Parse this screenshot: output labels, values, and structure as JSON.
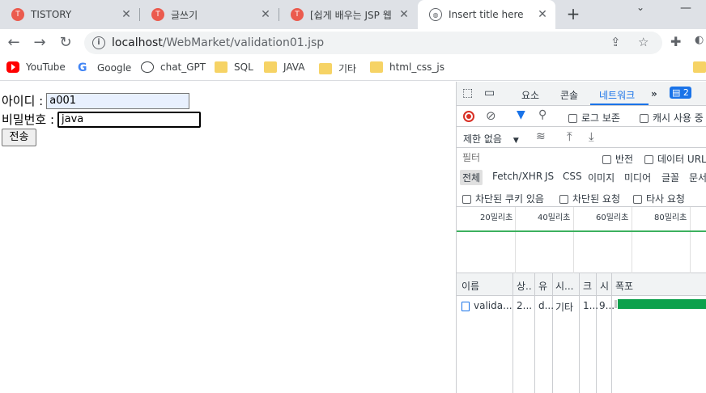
{
  "browser": {
    "tabs": [
      {
        "title": "TISTORY",
        "favicon": "tistory-icon"
      },
      {
        "title": "글쓰기",
        "favicon": "tistory-icon"
      },
      {
        "title": "[쉽게 배우는 JSP 웹",
        "favicon": "tistory-icon"
      },
      {
        "title": "Insert title here",
        "favicon": "globe-icon"
      }
    ],
    "url_host": "localhost",
    "url_path": "/WebMarket/validation01.jsp",
    "bookmarks": [
      {
        "label": "YouTube",
        "icon": "youtube-icon"
      },
      {
        "label": "Google",
        "icon": "google-icon"
      },
      {
        "label": "chat_GPT",
        "icon": "openai-icon"
      },
      {
        "label": "SQL",
        "icon": "folder-icon"
      },
      {
        "label": "JAVA",
        "icon": "folder-icon"
      },
      {
        "label": "기타",
        "icon": "folder-icon"
      },
      {
        "label": "html_css_js",
        "icon": "folder-icon"
      }
    ]
  },
  "form": {
    "id_label": "아이디 :",
    "id_value": "a001",
    "pw_label": "비밀번호 :",
    "pw_value": "java",
    "submit_label": "전송"
  },
  "devtools": {
    "tabs": [
      "요소",
      "콘솔",
      "네트워크"
    ],
    "issues_count": "2",
    "preserve_log": "로그 보존",
    "disable_cache": "캐시 사용 중",
    "throttle": "제한 없음",
    "filter_placeholder": "필터",
    "invert": "반전",
    "data_url": "데이터 URL",
    "types": [
      "전체",
      "Fetch/XHR",
      "JS",
      "CSS",
      "이미지",
      "미디어",
      "글꼴",
      "문서"
    ],
    "blocked_cookies": "차단된 쿠키 있음",
    "blocked_requests": "차단된 요청",
    "third_party": "타사 요청",
    "timeline_ticks": [
      "20밀리초",
      "40밀리초",
      "60밀리초",
      "80밀리초"
    ],
    "columns": [
      "이름",
      "상..",
      "유",
      "시...",
      "크",
      "시",
      "폭포"
    ],
    "rows": [
      {
        "name": "valida...",
        "status": "2...",
        "type": "d...",
        "initiator": "기타",
        "size": "1...",
        "time": "9..."
      }
    ]
  }
}
